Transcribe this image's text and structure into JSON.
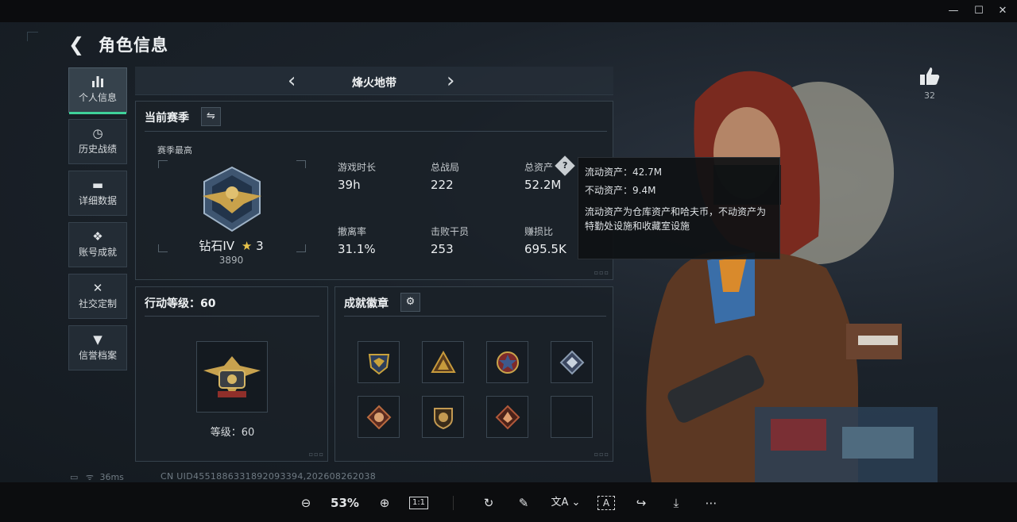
{
  "window": {
    "minimize": "—",
    "maximize": "☐",
    "close": "✕"
  },
  "header": {
    "title": "角色信息",
    "back_icon": "back-arrow-icon"
  },
  "sidebar": {
    "items": [
      {
        "label": "个人信息",
        "icon": "bar-chart-icon",
        "active": true
      },
      {
        "label": "历史战绩",
        "icon": "clock-icon",
        "active": false
      },
      {
        "label": "详细数据",
        "icon": "folder-icon",
        "active": false
      },
      {
        "label": "账号成就",
        "icon": "trophy-icon",
        "active": false
      },
      {
        "label": "社交定制",
        "icon": "tools-icon",
        "active": false
      },
      {
        "label": "信誉档案",
        "icon": "shield-icon",
        "active": false
      }
    ]
  },
  "mode": {
    "name": "烽火地带",
    "prev": "‹",
    "next": "›"
  },
  "season": {
    "title": "当前赛季",
    "best_label": "赛季最高",
    "rank_name": "钻石IV",
    "rank_star": "★",
    "rank_stars": "3",
    "rank_points": "3890",
    "stats": [
      {
        "label": "游戏时长",
        "value": "39h"
      },
      {
        "label": "总战局",
        "value": "222"
      },
      {
        "label": "总资产",
        "value": "52.2M"
      },
      {
        "label": "撤离率",
        "value": "31.1%"
      },
      {
        "label": "击败干员",
        "value": "253"
      },
      {
        "label": "赚损比",
        "value": "695.5K"
      }
    ]
  },
  "tooltip": {
    "liquid": "流动资产：42.7M",
    "fixed": "不动资产：9.4M",
    "note": "流动资产为仓库资产和哈夫币，不动资产为特勤处设施和收藏室设施"
  },
  "action_level": {
    "title": "行动等级：60",
    "level_text": "等级：60"
  },
  "badges": {
    "title": "成就徽章",
    "items": [
      {
        "name": "eagle-badge",
        "color": "#c9a23b"
      },
      {
        "name": "pyramid-badge",
        "color": "#c79a3c"
      },
      {
        "name": "star-badge",
        "color": "#b5453b"
      },
      {
        "name": "diamond-badge",
        "color": "#8a9bb0"
      },
      {
        "name": "fox-badge",
        "color": "#b86a3f"
      },
      {
        "name": "lion-badge",
        "color": "#c39a52"
      },
      {
        "name": "dragon-badge",
        "color": "#b0583a"
      },
      {
        "name": "empty-slot",
        "color": ""
      }
    ]
  },
  "like": {
    "icon": "thumbs-up-icon",
    "count": "32"
  },
  "status": {
    "battery": "▭",
    "wifi": "ᯤ",
    "ping": "36ms",
    "uid": "CN UID4551886331892093394,202608262038"
  },
  "viewer_toolbar": {
    "zoom": "53%",
    "ratio_label": "1:1"
  },
  "colors": {
    "accent": "#3fd29a",
    "panel_bg": "#1a2128",
    "border": "#36424c"
  }
}
